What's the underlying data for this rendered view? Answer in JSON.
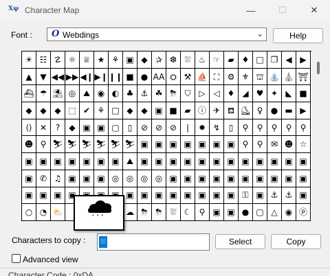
{
  "window": {
    "title": "Character Map",
    "icon_text": "Χψ",
    "min_symbol": "—",
    "max_symbol": "☐",
    "close_symbol": "✕"
  },
  "font": {
    "label": "Font :",
    "icon": "O",
    "value": "Webdings",
    "chevron": "⌄"
  },
  "help_button": "Help",
  "grid": {
    "rows": [
      [
        "☀",
        "☷",
        "☡",
        "☼",
        "♕",
        "★",
        "⚘",
        "▣",
        "◆",
        "✰",
        "❆",
        "⛆",
        "♨",
        "☞",
        "▰",
        "♦",
        "□",
        "❐",
        "◀",
        "▶"
      ],
      [
        "▲",
        "▼",
        "◀◀",
        "▶▶",
        "◀❙",
        "▶❙",
        "❙❙",
        "■",
        "●",
        "AA",
        "⛭",
        "⚒",
        "⛵",
        "⛶",
        "⚙",
        "⚜",
        "⛫",
        "⛲",
        "⛪",
        "⛩"
      ],
      [
        "⛴",
        "☂",
        "⛱",
        "◎",
        "⛰",
        "◉",
        "◐",
        "♣",
        "⚓",
        "☘",
        "⛈",
        "⛉",
        "▷",
        "◁",
        "♦",
        "◢",
        "♥",
        "✦",
        "◣",
        "■"
      ],
      [
        "◆",
        "◆",
        "◆",
        "⬚",
        "✔",
        "⚘",
        "□",
        "◆",
        "◆",
        "▣",
        "■",
        "▰",
        "ⓘ",
        "✈",
        "⛾",
        "⛸",
        "♀",
        "●",
        "▬",
        "▶"
      ],
      [
        "⟨⟩",
        "✕",
        "?",
        "◆",
        "▣",
        "▣",
        "▢",
        "▯",
        "⊘",
        "⊘",
        "⊘",
        "❘",
        "✹",
        "↯",
        "▯",
        "⚲",
        "⚲",
        "⚲",
        "⚲",
        "⚲"
      ],
      [
        "☻",
        "⚲",
        "⛷",
        "⛷",
        "⛷",
        "⛷",
        "⛷",
        "⛷",
        "▣",
        "▣",
        "▣",
        "▣",
        "▣",
        "▣",
        "▣",
        "⚲",
        "⚲",
        "✉",
        "☻",
        "☆"
      ],
      [
        "▣",
        "▣",
        "▣",
        "▣",
        "▣",
        "▣",
        "▣",
        "⛰",
        "▣",
        "▣",
        "▣",
        "▣",
        "▣",
        "▣",
        "▣",
        "▣",
        "▣",
        "▣",
        "▣",
        "▣"
      ],
      [
        "▣",
        "✆",
        "♫",
        "▣",
        "▣",
        "▣",
        "◎",
        "◎",
        "◎",
        "◎",
        "▣",
        "▣",
        "▣",
        "▣",
        "▣",
        "▣",
        "▣",
        "▣",
        "▣",
        "▣"
      ],
      [
        "▣",
        "▣",
        "▣",
        "▣",
        "▣",
        "▣",
        "▣",
        "▣",
        "▣",
        "▣",
        "▣",
        "▣",
        "▣",
        "▣",
        "▣",
        "⚿",
        "▣",
        "⚓",
        "⚓",
        "▣"
      ],
      [
        "○",
        "◔",
        "⛅",
        "",
        "",
        "",
        "",
        "☁",
        "⛈",
        "⛈",
        "⛆",
        "☾",
        "⚲",
        "▣",
        "▣",
        "●",
        "▢",
        "△",
        "◉",
        "ⓟ"
      ]
    ]
  },
  "popup": {
    "snow": "* * *"
  },
  "copy": {
    "label": "Characters to copy :",
    "value": "⛆",
    "select_label": "Select",
    "copy_label": "Copy"
  },
  "advanced": {
    "label": "Advanced view",
    "checked": false
  },
  "status": {
    "text": "Character Code : 0xDA"
  }
}
